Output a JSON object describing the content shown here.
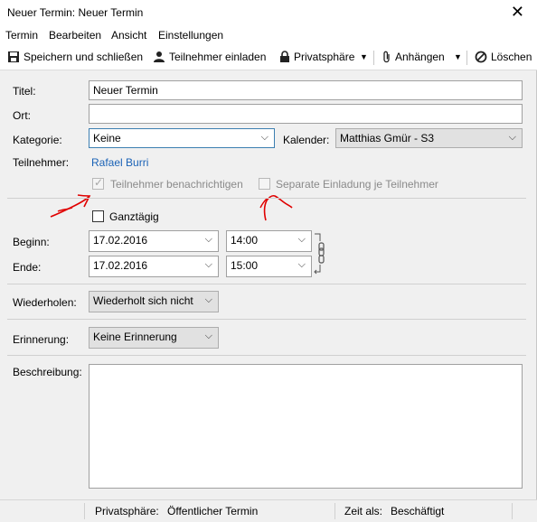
{
  "window": {
    "title": "Neuer Termin: Neuer Termin"
  },
  "menu": {
    "termin": "Termin",
    "bearbeiten": "Bearbeiten",
    "ansicht": "Ansicht",
    "einstellungen": "Einstellungen"
  },
  "toolbar": {
    "save_close": "Speichern und schließen",
    "invite": "Teilnehmer einladen",
    "privacy": "Privatsphäre",
    "attach": "Anhängen",
    "delete": "Löschen"
  },
  "form": {
    "title_label": "Titel:",
    "title_value": "Neuer Termin",
    "location_label": "Ort:",
    "location_value": "",
    "category_label": "Kategorie:",
    "category_value": "Keine",
    "calendar_label": "Kalender:",
    "calendar_value": "Matthias Gmür - S3",
    "attendees_label": "Teilnehmer:",
    "attendee_name": "Rafael Burri",
    "notify_label": "Teilnehmer benachrichtigen",
    "notify_checked": true,
    "separate_invite_label": "Separate Einladung je Teilnehmer",
    "separate_invite_checked": false,
    "allday_label": "Ganztägig",
    "allday_checked": false,
    "start_label": "Beginn:",
    "start_date": "17.02.2016",
    "start_time": "14:00",
    "end_label": "Ende:",
    "end_date": "17.02.2016",
    "end_time": "15:00",
    "repeat_label": "Wiederholen:",
    "repeat_value": "Wiederholt sich nicht",
    "reminder_label": "Erinnerung:",
    "reminder_value": "Keine Erinnerung",
    "description_label": "Beschreibung:",
    "description_value": ""
  },
  "statusbar": {
    "privacy_label": "Privatsphäre:",
    "privacy_value": "Öffentlicher Termin",
    "showas_label": "Zeit als:",
    "showas_value": "Beschäftigt"
  },
  "colors": {
    "link": "#1a62b6",
    "annotation": "#e00000",
    "focus_border": "#3c7fb1"
  },
  "icons": [
    "close-icon",
    "save-icon",
    "user-icon",
    "lock-icon",
    "paperclip-icon",
    "delete-icon",
    "chevron-down-icon",
    "link-chain-icon"
  ]
}
